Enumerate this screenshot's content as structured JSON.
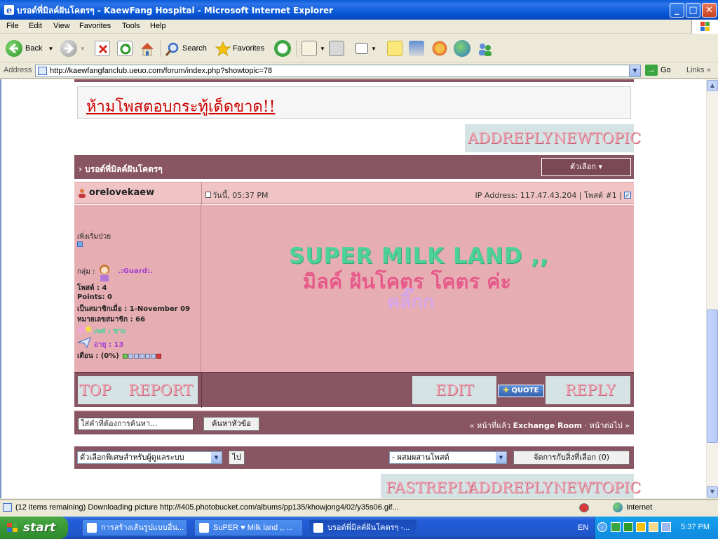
{
  "window": {
    "title": "บรอด์พี่มิลค์ฝันโคตรๆ - KaewFang Hospital - Microsoft Internet Explorer",
    "min": "_",
    "max": "□",
    "close": "✕"
  },
  "menu": [
    "File",
    "Edit",
    "View",
    "Favorites",
    "Tools",
    "Help"
  ],
  "toolbar": {
    "back": "Back",
    "search": "Search",
    "favorites": "Favorites"
  },
  "address": {
    "label": "Address",
    "url": "http://kaewfangfanclub.ueuo.com/forum/index.php?showtopic=78",
    "go": "Go",
    "links": "Links"
  },
  "forum": {
    "rule_text": "ห้ามโพสตอบกระทู้เด็ดขาด!!",
    "top_buttons": [
      "ADDREPLY",
      "NEWTOPIC"
    ],
    "topic_title": "บรอด์พี่มิลค์ฝันโคตรๆ",
    "options_label": "ตัวเลือก",
    "post": {
      "author": "orelovekaew",
      "date": "วันนี้, 05:37 PM",
      "ip": "IP Address: 117.47.43.204 | โพสต์ #1 |",
      "rank": "เพิ่งเริ่มป่วย",
      "group_label": "กลุ่ม :",
      "group_value": ".:Guard:.",
      "posts": "โพสต์ : 4",
      "points": "Points: 0",
      "joined": "เป็นสมาชิกเมื่อ : 1-November 09",
      "member_no": "หมายเลขสมาชิก : 66",
      "gender": "เพศ : ชาย",
      "age": "อายุ : 13",
      "warn": "เตือน : (0%)",
      "body_line1": "SUPER MILK LAND ,,",
      "body_line2": "มิลค์ ฝันโคตร โคตร ค่ะ",
      "body_line3": "คลิ๊กก"
    },
    "post_buttons": {
      "top": "TOP",
      "report": "REPORT",
      "edit": "EDIT",
      "quote": "QUOTE",
      "reply": "REPLY"
    },
    "search_placeholder": "ใส่คำที่ต้องการค้นหา...",
    "search_button": "ค้นหาหัวข้อ",
    "nav_prev": "« หน้าที่แล้ว",
    "nav_room": "Exchange Room",
    "nav_next": "· หน้าต่อไป »",
    "mod_select": "ตัวเลือกพิเศษสำหรับผู้ดูแลระบบ",
    "mod_go": "ไป",
    "merge_select": "- ผสมผสานโพสต์",
    "manage_button": "จัดการกับสิ่งที่เลือก (0)",
    "bottom_buttons": [
      "FASTREPLY",
      "ADDREPLY",
      "NEWTOPIC"
    ]
  },
  "status": {
    "text": "(12 items remaining) Downloading picture http://i405.photobucket.com/albums/pp135/khowjong4/02/y35s06.gif...",
    "zone": "Internet"
  },
  "taskbar": {
    "start": "start",
    "tasks": [
      "การสร้างเส้นรูปแบบอื่น...",
      "SuPER ♥ Milk land ,, ...",
      "บรอด์พี่มิลค์ฝันโคตรๆ -..."
    ],
    "lang": "EN",
    "clock": "5:37 PM"
  },
  "colors": {
    "forum_maroon": "#8a5562",
    "post_pink": "#e6aeb3",
    "button_pink": "#f2a3b1"
  }
}
